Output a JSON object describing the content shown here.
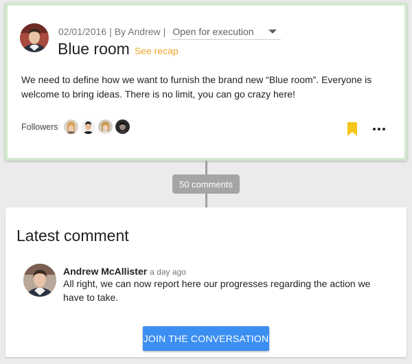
{
  "post": {
    "date": "02/01/2016",
    "separator": "|",
    "by_label": "By Andrew",
    "status": "Open for execution",
    "title": "Blue room",
    "recap_link": "See recap",
    "description": "We need to define how we want to furnish the brand new “Blue room”. Everyone is welcome to bring ideas. There is no limit, you can go crazy here!",
    "followers_label": "Followers",
    "icons": [
      "user-avatar",
      "bookmark-icon",
      "more-icon",
      "chevron-down-icon"
    ]
  },
  "comments_count_label": "50 comments",
  "latest": {
    "heading": "Latest comment",
    "author": "Andrew McAllister",
    "time": "a day ago",
    "text": "All right, we can now report here our progresses regarding the action we have to take.",
    "join_button": "JOIN THE CONVERSATION"
  },
  "colors": {
    "card_border": "#d1e8cd",
    "recap": "#f1a52b",
    "bookmark": "#f5c518",
    "button": "#3c8ff2",
    "pill": "#a5a5a5"
  }
}
